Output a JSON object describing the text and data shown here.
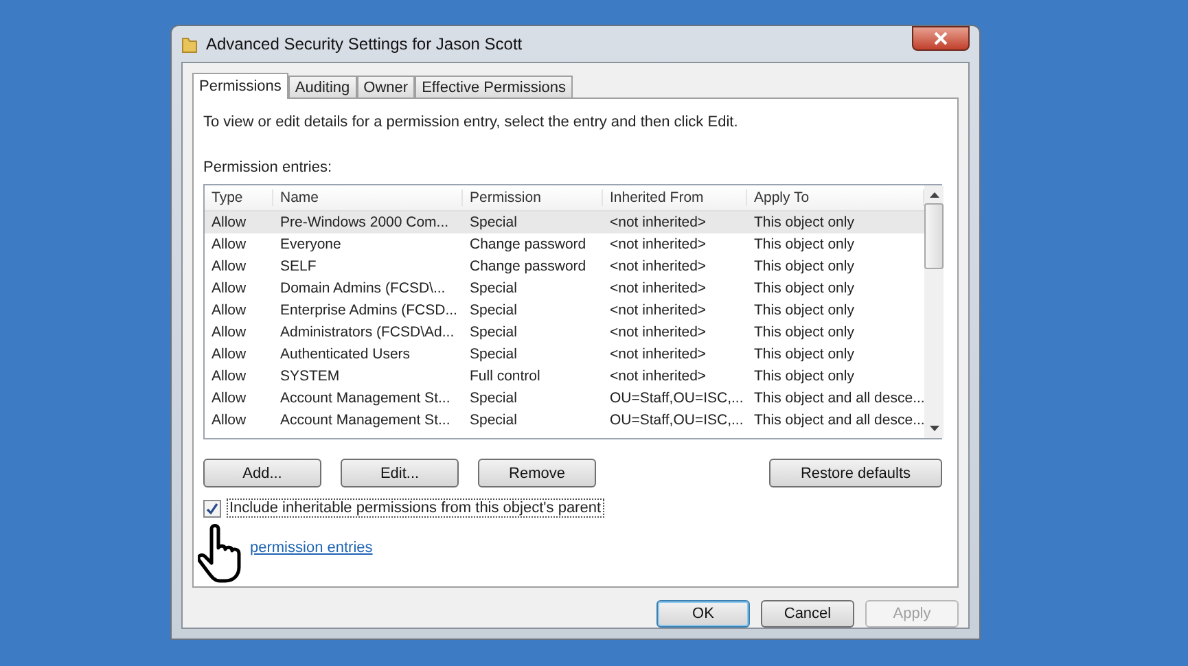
{
  "window": {
    "title": "Advanced Security Settings for Jason Scott"
  },
  "tabs": [
    {
      "label": "Permissions",
      "selected": true
    },
    {
      "label": "Auditing",
      "selected": false
    },
    {
      "label": "Owner",
      "selected": false
    },
    {
      "label": "Effective Permissions",
      "selected": false
    }
  ],
  "instructions": "To view or edit details for a permission entry, select the entry and then click Edit.",
  "entries_label": "Permission entries:",
  "table": {
    "columns": [
      "Type",
      "Name",
      "Permission",
      "Inherited From",
      "Apply To"
    ],
    "rows": [
      {
        "cells": [
          "Allow",
          "Pre-Windows 2000 Com...",
          "Special",
          "<not inherited>",
          "This object only"
        ],
        "selected": true
      },
      {
        "cells": [
          "Allow",
          "Everyone",
          "Change password",
          "<not inherited>",
          "This object only"
        ],
        "selected": false
      },
      {
        "cells": [
          "Allow",
          "SELF",
          "Change password",
          "<not inherited>",
          "This object only"
        ],
        "selected": false
      },
      {
        "cells": [
          "Allow",
          "Domain Admins (FCSD\\...",
          "Special",
          "<not inherited>",
          "This object only"
        ],
        "selected": false
      },
      {
        "cells": [
          "Allow",
          "Enterprise Admins (FCSD...",
          "Special",
          "<not inherited>",
          "This object only"
        ],
        "selected": false
      },
      {
        "cells": [
          "Allow",
          "Administrators (FCSD\\Ad...",
          "Special",
          "<not inherited>",
          "This object only"
        ],
        "selected": false
      },
      {
        "cells": [
          "Allow",
          "Authenticated Users",
          "Special",
          "<not inherited>",
          "This object only"
        ],
        "selected": false
      },
      {
        "cells": [
          "Allow",
          "SYSTEM",
          "Full control",
          "<not inherited>",
          "This object only"
        ],
        "selected": false
      },
      {
        "cells": [
          "Allow",
          "Account Management St...",
          "Special",
          "OU=Staff,OU=ISC,...",
          "This object and all desce..."
        ],
        "selected": false
      },
      {
        "cells": [
          "Allow",
          "Account Management St...",
          "Special",
          "OU=Staff,OU=ISC,...",
          "This object and all desce..."
        ],
        "selected": false
      }
    ]
  },
  "entry_buttons": [
    "Add...",
    "Edit...",
    "Remove"
  ],
  "restore_button": "Restore defaults",
  "inherit_checkbox": {
    "label": "Include inheritable permissions from this object's parent",
    "checked": true
  },
  "link": "permission entries",
  "dialog_buttons": [
    {
      "label": "OK",
      "disabled": false
    },
    {
      "label": "Cancel",
      "disabled": false
    },
    {
      "label": "Apply",
      "disabled": true
    }
  ]
}
